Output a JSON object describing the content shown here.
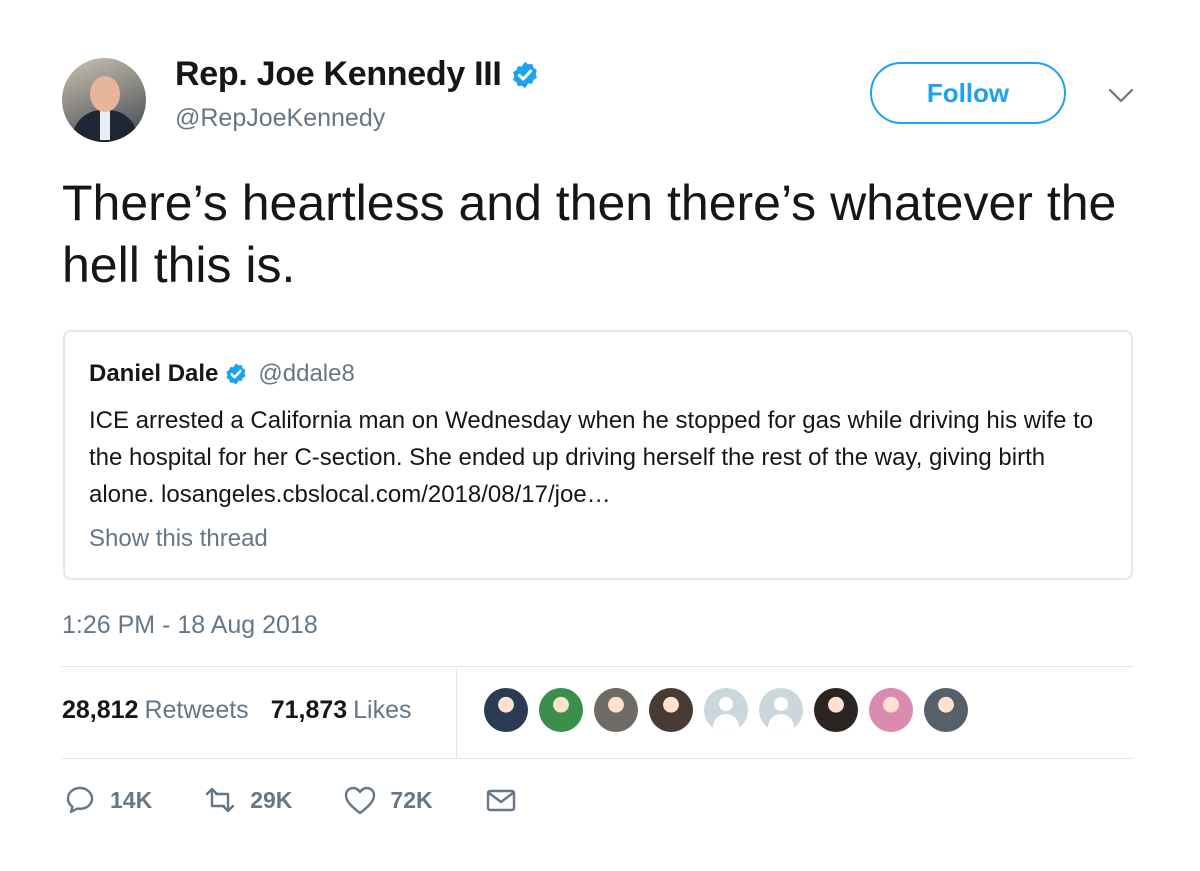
{
  "author": {
    "display_name": "Rep. Joe Kennedy III",
    "handle": "@RepJoeKennedy",
    "verified": true,
    "avatar_icon": "avatar-photo-icon"
  },
  "follow_label": "Follow",
  "tweet_text": "There’s heartless and then there’s whatever the hell this is.",
  "quoted_tweet": {
    "display_name": "Daniel Dale",
    "handle": "@ddale8",
    "verified": true,
    "text": "ICE arrested a California man on Wednesday when he stopped for gas while driving his wife to the hospital for her C-section. She ended up driving herself the rest of the way, giving birth alone. losangeles.cbslocal.com/2018/08/17/joe…",
    "show_thread": "Show this thread"
  },
  "timestamp": "1:26 PM - 18 Aug 2018",
  "stats": {
    "retweets_count": "28,812",
    "retweets_label": "Retweets",
    "likes_count": "71,873",
    "likes_label": "Likes"
  },
  "likers": [
    {
      "name": "liker-avatar-1",
      "color": "#2b3a55"
    },
    {
      "name": "liker-avatar-2",
      "color": "#3a8f4a"
    },
    {
      "name": "liker-avatar-3",
      "color": "#6e6a66"
    },
    {
      "name": "liker-avatar-4",
      "color": "#4a3a34"
    },
    {
      "name": "liker-avatar-5",
      "color": "default"
    },
    {
      "name": "liker-avatar-6",
      "color": "default"
    },
    {
      "name": "liker-avatar-7",
      "color": "#2a2422"
    },
    {
      "name": "liker-avatar-8",
      "color": "#d98bb0"
    },
    {
      "name": "liker-avatar-9",
      "color": "#55606a"
    }
  ],
  "actions": {
    "reply_count": "14K",
    "retweet_count": "29K",
    "like_count": "72K"
  },
  "colors": {
    "accent": "#1da1f2",
    "secondary_text": "#657786",
    "border": "#e1e8ed"
  }
}
